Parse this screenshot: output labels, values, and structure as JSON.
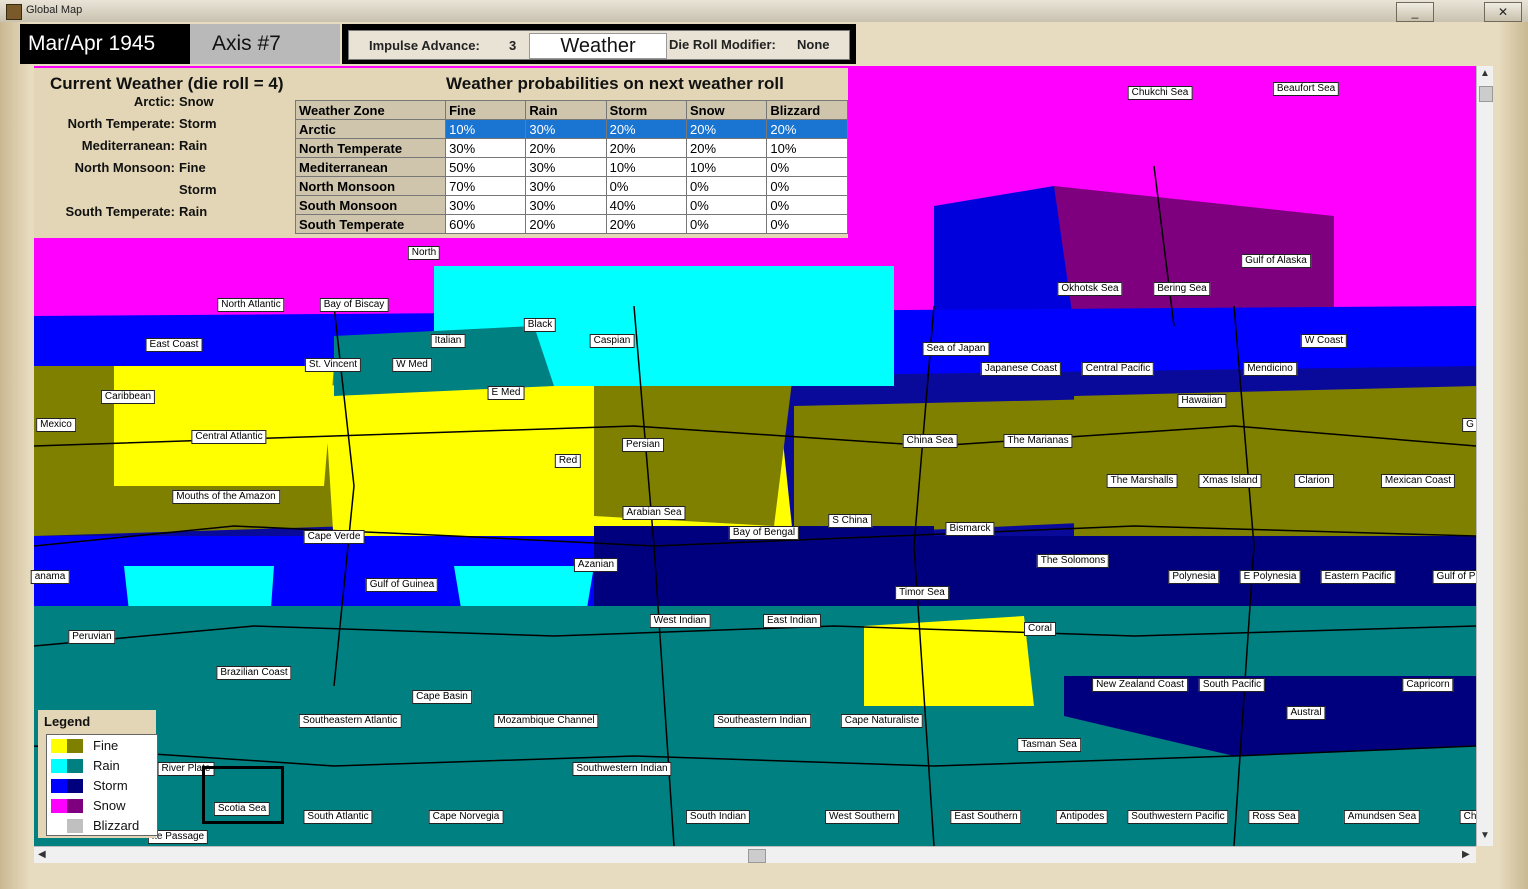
{
  "window": {
    "title": "Global Map",
    "min": "_",
    "max": "□",
    "close": "✕"
  },
  "hud": {
    "date": "Mar/Apr 1945",
    "side": "Axis #7",
    "impulse_label": "Impulse Advance:",
    "impulse_value": "3",
    "weather_button": "Weather",
    "die_mod_label": "Die Roll Modifier:",
    "die_mod_value": "None"
  },
  "weather": {
    "current_title": "Current Weather (die roll = 4)",
    "prob_title": "Weather probabilities on next weather roll",
    "current": [
      {
        "zone": "Arctic:",
        "value": "Snow"
      },
      {
        "zone": "North Temperate:",
        "value": "Storm"
      },
      {
        "zone": "Mediterranean:",
        "value": "Rain"
      },
      {
        "zone": "North Monsoon:",
        "value": "Fine"
      },
      {
        "zone": "",
        "value": "Storm"
      },
      {
        "zone": "South Temperate:",
        "value": "Rain"
      }
    ],
    "headers": [
      "Weather Zone",
      "Fine",
      "Rain",
      "Storm",
      "Snow",
      "Blizzard"
    ],
    "rows": [
      [
        "Arctic",
        "10%",
        "30%",
        "20%",
        "20%",
        "20%"
      ],
      [
        "North Temperate",
        "30%",
        "20%",
        "20%",
        "20%",
        "10%"
      ],
      [
        "Mediterranean",
        "50%",
        "30%",
        "10%",
        "10%",
        "0%"
      ],
      [
        "North Monsoon",
        "70%",
        "30%",
        "0%",
        "0%",
        "0%"
      ],
      [
        "South Monsoon",
        "30%",
        "30%",
        "40%",
        "0%",
        "0%"
      ],
      [
        "South Temperate",
        "60%",
        "20%",
        "20%",
        "0%",
        "0%"
      ]
    ]
  },
  "legend": {
    "title": "Legend",
    "items": [
      {
        "label": "Fine",
        "c1": "#ffff00",
        "c2": "#7f7f00"
      },
      {
        "label": "Rain",
        "c1": "#00ffff",
        "c2": "#008080"
      },
      {
        "label": "Storm",
        "c1": "#0000ff",
        "c2": "#00007f"
      },
      {
        "label": "Snow",
        "c1": "#ff00ff",
        "c2": "#7f007f"
      },
      {
        "label": "Blizzard",
        "c1": "#ffffff",
        "c2": "#c0c0c0"
      }
    ]
  },
  "sea_zones": [
    "Chukchi Sea",
    "Beaufort Sea",
    "North",
    "North Atlantic",
    "Bay of Biscay",
    "Black",
    "Italian",
    "Caspian",
    "Sea of Japan",
    "W Coast",
    "Okhotsk Sea",
    "Bering Sea",
    "Gulf of Alaska",
    "East Coast",
    "St. Vincent",
    "W Med",
    "E Med",
    "Japanese Coast",
    "Central Pacific",
    "Mendicino",
    "Caribbean",
    "Mexico",
    "Central Atlantic",
    "Hawaiian",
    "Persian",
    "China Sea",
    "The Marianas",
    "Red",
    "Mouths of the Amazon",
    "The Marshalls",
    "Xmas Island",
    "Clarion",
    "Mexican Coast",
    "G",
    "Arabian Sea",
    "S China",
    "Bismarck",
    "Bay of Bengal",
    "Cape Verde",
    "The Solomons",
    "Azanian",
    "anama",
    "Gulf of Guinea",
    "Polynesia",
    "E Polynesia",
    "Eastern Pacific",
    "Gulf of P",
    "Timor Sea",
    "West Indian",
    "East Indian",
    "Peruvian",
    "Coral",
    "Brazilian Coast",
    "Cape Basin",
    "New Zealand Coast",
    "South Pacific",
    "Capricorn",
    "Austral",
    "Southeastern Atlantic",
    "Mozambique Channel",
    "Southeastern Indian",
    "Cape Naturaliste",
    "Tasman Sea",
    "River Plate",
    "Southwestern Indian",
    "Scotia Sea",
    "South Atlantic",
    "Cape Norvegia",
    "South Indian",
    "West Southern",
    "East Southern",
    "Antipodes",
    "Southwestern Pacific",
    "Ross Sea",
    "Amundsen Sea",
    "Ch",
    "ke Passage"
  ]
}
